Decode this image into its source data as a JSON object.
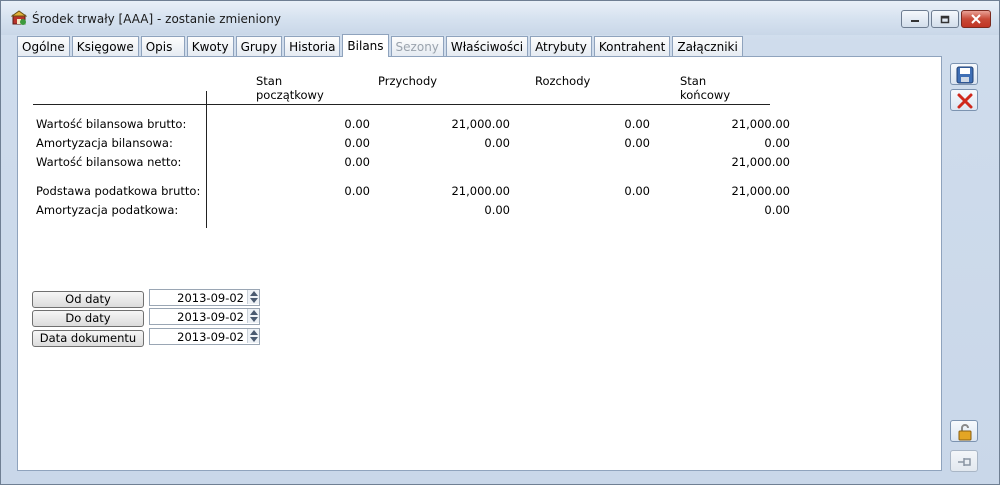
{
  "window": {
    "title": "Środek trwały [AAA] - zostanie zmieniony",
    "icon": "fixed-asset-app-icon"
  },
  "tabs": [
    {
      "label": "Ogólne",
      "state": "normal"
    },
    {
      "label": "Księgowe",
      "state": "normal"
    },
    {
      "label": "Opis",
      "state": "normal"
    },
    {
      "label": "Kwoty",
      "state": "normal"
    },
    {
      "label": "Grupy",
      "state": "normal"
    },
    {
      "label": "Historia",
      "state": "normal"
    },
    {
      "label": "Bilans",
      "state": "active"
    },
    {
      "label": "Sezony",
      "state": "disabled"
    },
    {
      "label": "Właściwości",
      "state": "normal"
    },
    {
      "label": "Atrybuty",
      "state": "normal"
    },
    {
      "label": "Kontrahent",
      "state": "normal"
    },
    {
      "label": "Załączniki",
      "state": "normal"
    }
  ],
  "balance": {
    "columns": [
      "Stan\npoczątkowy",
      "Przychody",
      "Rozchody",
      "Stan\nkońcowy"
    ],
    "rows": [
      {
        "label": "Wartość bilansowa brutto:",
        "values": [
          "0.00",
          "21,000.00",
          "0.00",
          "21,000.00"
        ]
      },
      {
        "label": "Amortyzacja bilansowa:",
        "values": [
          "0.00",
          "0.00",
          "0.00",
          "0.00"
        ]
      },
      {
        "label": "Wartość bilansowa netto:",
        "values": [
          "0.00",
          "",
          "",
          "21,000.00"
        ]
      },
      {
        "label": "Podstawa podatkowa brutto:",
        "values": [
          "0.00",
          "21,000.00",
          "0.00",
          "21,000.00"
        ]
      },
      {
        "label": "Amortyzacja podatkowa:",
        "values": [
          "",
          "0.00",
          "",
          "0.00"
        ]
      }
    ]
  },
  "dates": [
    {
      "button": "Od daty",
      "value": "2013-09-02"
    },
    {
      "button": "Do daty",
      "value": "2013-09-02"
    },
    {
      "button": "Data dokumentu",
      "value": "2013-09-02"
    }
  ],
  "colors": {
    "save_accent": "#3f6fb5",
    "cancel_accent": "#d0281b"
  }
}
